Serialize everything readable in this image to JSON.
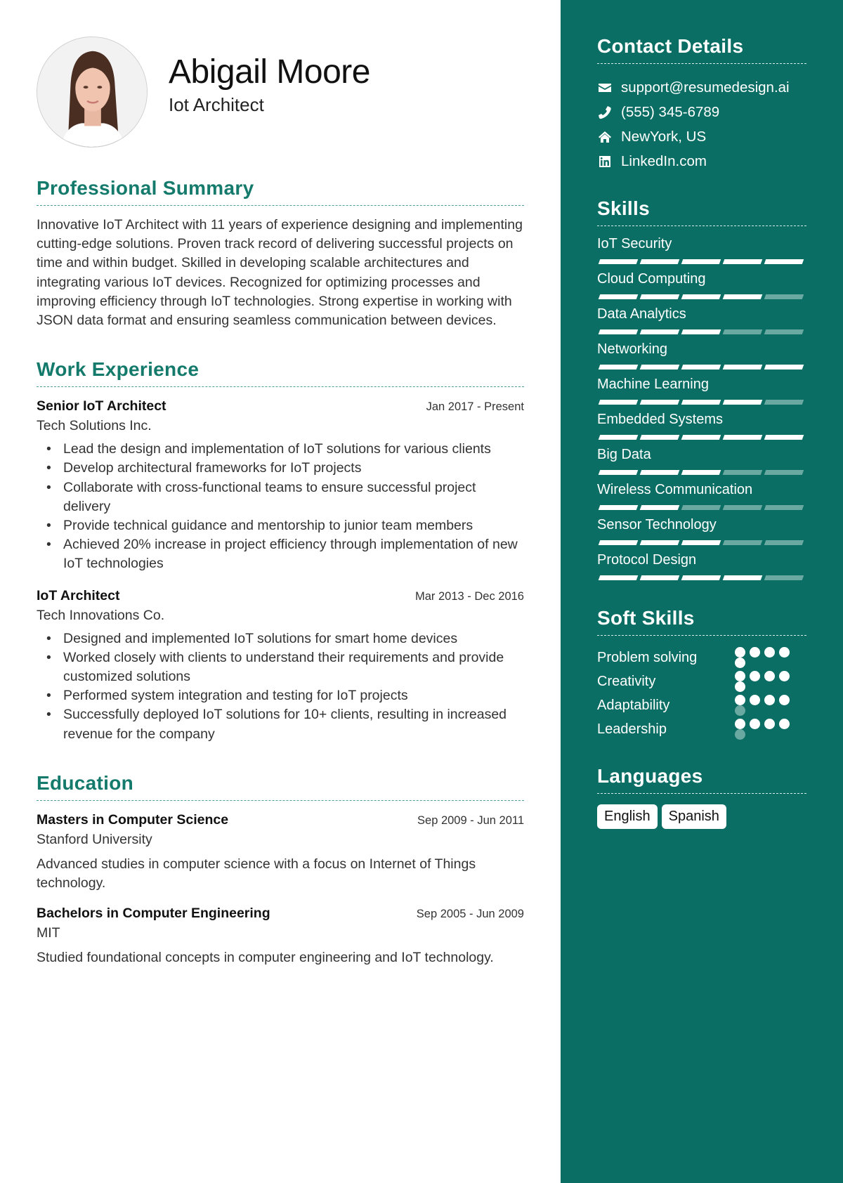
{
  "header": {
    "name": "Abigail Moore",
    "role": "Iot Architect"
  },
  "summary": {
    "title": "Professional Summary",
    "text": "Innovative IoT Architect with 11 years of experience designing and implementing cutting-edge solutions. Proven track record of delivering successful projects on time and within budget. Skilled in developing scalable architectures and integrating various IoT devices. Recognized for optimizing processes and improving efficiency through IoT technologies. Strong expertise in working with JSON data format and ensuring seamless communication between devices."
  },
  "experience": {
    "title": "Work Experience",
    "jobs": [
      {
        "title": "Senior IoT Architect",
        "date": "Jan 2017 - Present",
        "company": "Tech Solutions Inc.",
        "bullets": [
          "Lead the design and implementation of IoT solutions for various clients",
          "Develop architectural frameworks for IoT projects",
          "Collaborate with cross-functional teams to ensure successful project delivery",
          "Provide technical guidance and mentorship to junior team members",
          "Achieved 20% increase in project efficiency through implementation of new IoT technologies"
        ]
      },
      {
        "title": "IoT Architect",
        "date": "Mar 2013 - Dec 2016",
        "company": "Tech Innovations Co.",
        "bullets": [
          "Designed and implemented IoT solutions for smart home devices",
          "Worked closely with clients to understand their requirements and provide customized solutions",
          "Performed system integration and testing for IoT projects",
          "Successfully deployed IoT solutions for 10+ clients, resulting in increased revenue for the company"
        ]
      }
    ]
  },
  "education": {
    "title": "Education",
    "items": [
      {
        "degree": "Masters in Computer Science",
        "date": "Sep 2009 - Jun 2011",
        "school": "Stanford University",
        "description": "Advanced studies in computer science with a focus on Internet of Things technology."
      },
      {
        "degree": "Bachelors in Computer Engineering",
        "date": "Sep 2005 - Jun 2009",
        "school": "MIT",
        "description": "Studied foundational concepts in computer engineering and IoT technology."
      }
    ]
  },
  "contact": {
    "title": "Contact Details",
    "items": [
      {
        "icon": "envelope-icon",
        "text": "support@resumedesign.ai"
      },
      {
        "icon": "phone-icon",
        "text": "(555) 345-6789"
      },
      {
        "icon": "home-icon",
        "text": "NewYork, US"
      },
      {
        "icon": "linkedin-icon",
        "text": "LinkedIn.com"
      }
    ]
  },
  "skills": {
    "title": "Skills",
    "max": 5,
    "items": [
      {
        "name": "IoT Security",
        "level": 5
      },
      {
        "name": "Cloud Computing",
        "level": 4
      },
      {
        "name": "Data Analytics",
        "level": 3
      },
      {
        "name": "Networking",
        "level": 5
      },
      {
        "name": "Machine Learning",
        "level": 4
      },
      {
        "name": "Embedded Systems",
        "level": 5
      },
      {
        "name": "Big Data",
        "level": 3
      },
      {
        "name": "Wireless Communication",
        "level": 2
      },
      {
        "name": "Sensor Technology",
        "level": 3
      },
      {
        "name": "Protocol Design",
        "level": 4
      }
    ]
  },
  "soft_skills": {
    "title": "Soft Skills",
    "items": [
      {
        "name": "Problem solving",
        "level": 5,
        "max": 5
      },
      {
        "name": "Creativity",
        "level": 5,
        "max": 5
      },
      {
        "name": "Adaptability",
        "level": 4,
        "max": 5
      },
      {
        "name": "Leadership",
        "level": 4,
        "max": 5
      }
    ]
  },
  "languages": {
    "title": "Languages",
    "items": [
      "English",
      "Spanish"
    ]
  }
}
